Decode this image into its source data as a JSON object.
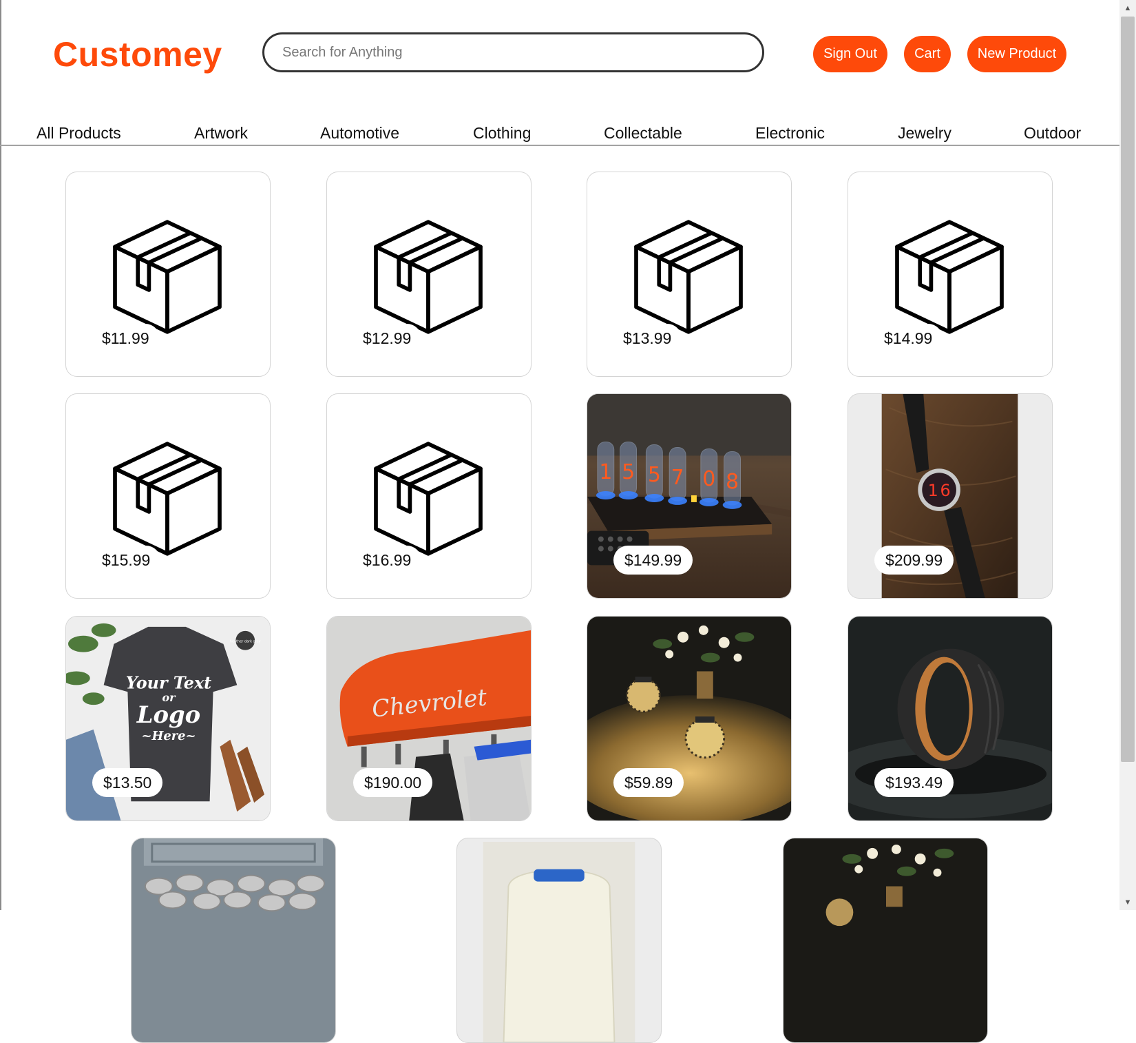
{
  "header": {
    "logo": "Customey",
    "search_placeholder": "Search for Anything",
    "buttons": {
      "sign_out": "Sign Out",
      "cart": "Cart",
      "new_product": "New Product"
    }
  },
  "nav": {
    "items": [
      "All Products",
      "Artwork",
      "Automotive",
      "Clothing",
      "Collectable",
      "Electronic",
      "Jewelry",
      "Outdoor"
    ]
  },
  "products": [
    {
      "price": "$11.99"
    },
    {
      "price": "$12.99"
    },
    {
      "price": "$13.99"
    },
    {
      "price": "$14.99"
    },
    {
      "price": "$15.99"
    },
    {
      "price": "$16.99"
    },
    {
      "price": "$149.99",
      "image": "nixie-tube-clock",
      "digits": [
        "1",
        "5",
        "5",
        "7",
        "0",
        "8"
      ]
    },
    {
      "price": "$209.99",
      "image": "nixie-wristwatch",
      "digits": [
        "1",
        "6"
      ]
    },
    {
      "price": "$13.50",
      "image": "custom-tshirt",
      "shirt_text": [
        "Your Text",
        "or",
        "Logo",
        "~Here~"
      ],
      "tag": "heather dark grey"
    },
    {
      "price": "$190.00",
      "image": "chevrolet-valve-cover-coat-rack",
      "script": "Chevrolet"
    },
    {
      "price": "$59.89",
      "image": "solar-lanterns"
    },
    {
      "price": "$193.49",
      "image": "carbon-wood-ring"
    }
  ],
  "colors": {
    "accent": "#fe4a0a",
    "border": "#d4d4d4"
  }
}
